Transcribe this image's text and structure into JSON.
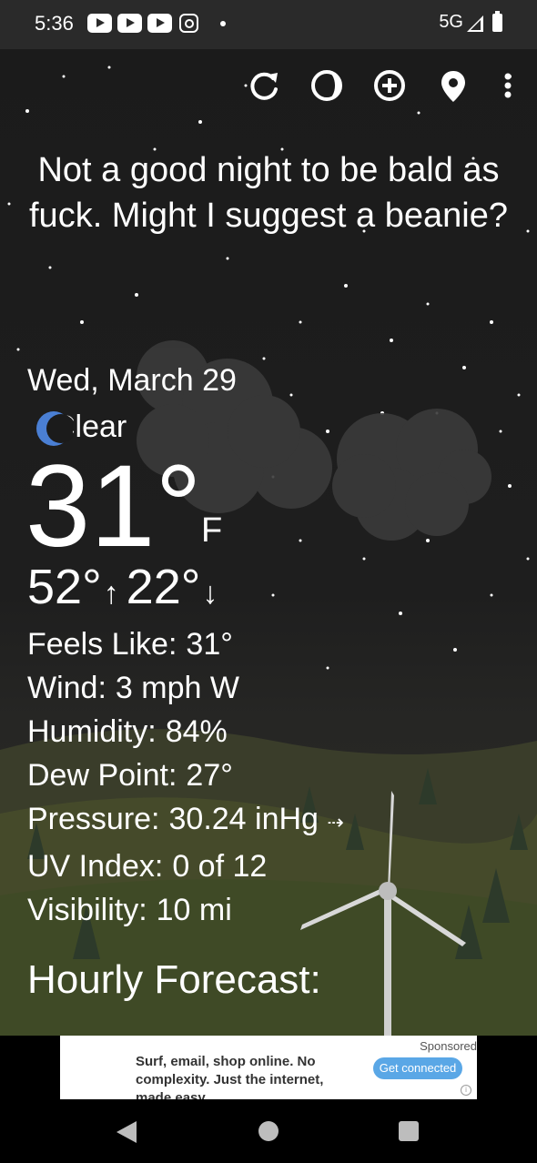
{
  "status_bar": {
    "time": "5:36",
    "network": "5G",
    "icons": [
      "youtube-icon",
      "youtube-icon",
      "youtube-icon",
      "instagram-icon",
      "dot-icon",
      "signal-icon",
      "battery-icon"
    ]
  },
  "toolbar": {
    "icons": [
      "refresh-icon",
      "theme-icon",
      "add-location-icon",
      "location-pin-icon",
      "more-vert-icon"
    ]
  },
  "headline": "Not a good night to be bald as fuck. Might I suggest a beanie?",
  "weather": {
    "date": "Wed, March 29",
    "condition": "Clear",
    "condition_icon": "moon-icon",
    "temperature": "31°",
    "unit": "F",
    "high": "52°",
    "low": "22°",
    "details": [
      {
        "label": "Feels Like:",
        "value": "31°"
      },
      {
        "label": "Wind:",
        "value": "3 mph W"
      },
      {
        "label": "Humidity:",
        "value": "84%"
      },
      {
        "label": "Dew Point:",
        "value": "27°"
      },
      {
        "label": "Pressure:",
        "value": "30.24 inHg",
        "trend": "⇢"
      },
      {
        "label": "UV Index:",
        "value": "0 of 12"
      },
      {
        "label": "Visibility:",
        "value": "10 mi"
      }
    ],
    "hourly_title": "Hourly Forecast:"
  },
  "ad": {
    "sponsored": "Sponsored",
    "text": "Surf, email, shop online. No complexity. Just the internet, made easy.",
    "cta": "Get connected",
    "info": "i"
  },
  "colors": {
    "sky": "#1b1b1b",
    "accent_moon": "#4a7fd4",
    "ad_button": "#5aa7e6"
  }
}
